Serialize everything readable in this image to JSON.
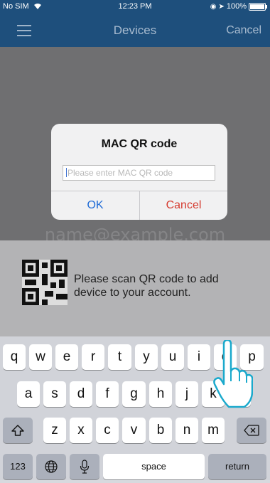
{
  "status_bar": {
    "carrier": "No SIM",
    "time": "12:23 PM",
    "battery": "100%"
  },
  "nav": {
    "title": "Devices",
    "cancel": "Cancel",
    "menu_icon": "menu-icon"
  },
  "camera": {
    "email_hint": "name@example.com"
  },
  "scan": {
    "instruction": "Please scan QR code to add device to your account."
  },
  "alert": {
    "title": "MAC QR code",
    "input_placeholder": "Please enter MAC QR code",
    "input_value": "",
    "ok": "OK",
    "cancel": "Cancel"
  },
  "keyboard": {
    "row1": [
      "q",
      "w",
      "e",
      "r",
      "t",
      "y",
      "u",
      "i",
      "o",
      "p"
    ],
    "row2": [
      "a",
      "s",
      "d",
      "f",
      "g",
      "h",
      "j",
      "k",
      "l"
    ],
    "row3": [
      "z",
      "x",
      "c",
      "v",
      "b",
      "n",
      "m"
    ],
    "numbers": "123",
    "space": "space",
    "return": "return"
  },
  "colors": {
    "nav_bg": "#1e4f7c",
    "ok": "#1f6bd6",
    "cancel": "#d53b2f"
  }
}
